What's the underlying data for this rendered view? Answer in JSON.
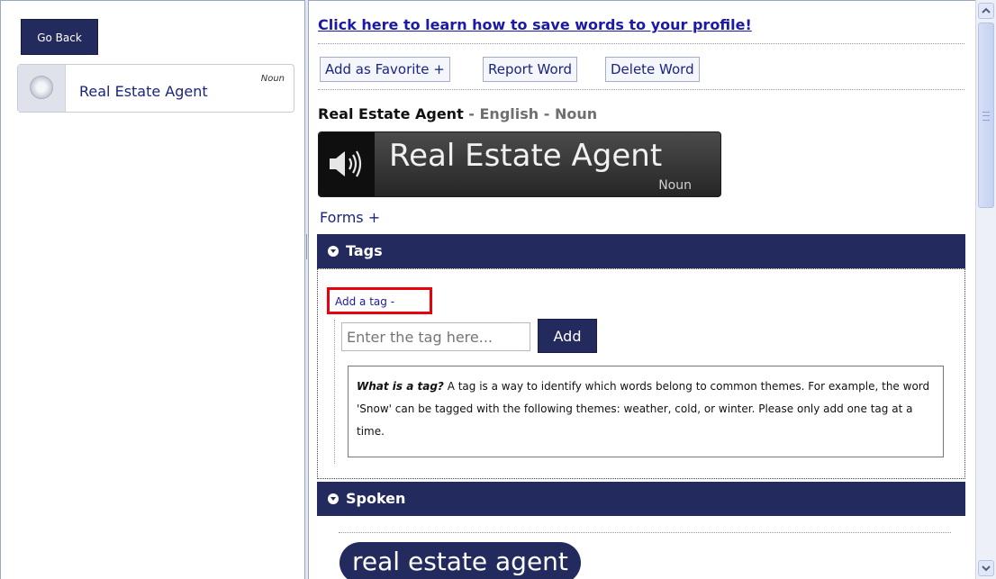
{
  "left_panel": {
    "go_back_label": "Go Back",
    "word_item": {
      "label": "Real Estate Agent",
      "part_of_speech": "Noun"
    }
  },
  "main": {
    "learn_link": "Click here to learn how to save words to your profile!",
    "buttons": {
      "favorite": "Add as Favorite +",
      "report": "Report Word",
      "delete": "Delete Word"
    },
    "title": {
      "word": "Real Estate Agent",
      "sep1": " - ",
      "language": "English",
      "sep2": " - ",
      "pos": "Noun"
    },
    "audio": {
      "word": "Real Estate Agent",
      "pos": "Noun",
      "icon": "speaker-icon"
    },
    "forms_link": "Forms +",
    "tags_section": {
      "header": "Tags",
      "add_tag_link": "Add a tag -",
      "input_placeholder": "Enter the tag here...",
      "add_button": "Add",
      "info_title": "What is a tag?",
      "info_text": " A tag is a way to identify which words belong to common themes. For example, the word 'Snow' can be tagged with the following themes: weather, cold, or winter. Please only add one tag at a time."
    },
    "spoken_section": {
      "header": "Spoken",
      "pill_text": "real estate agent"
    }
  },
  "colors": {
    "navy": "#232b5e",
    "link": "#1a1aa6",
    "highlight": "#e8000c"
  }
}
